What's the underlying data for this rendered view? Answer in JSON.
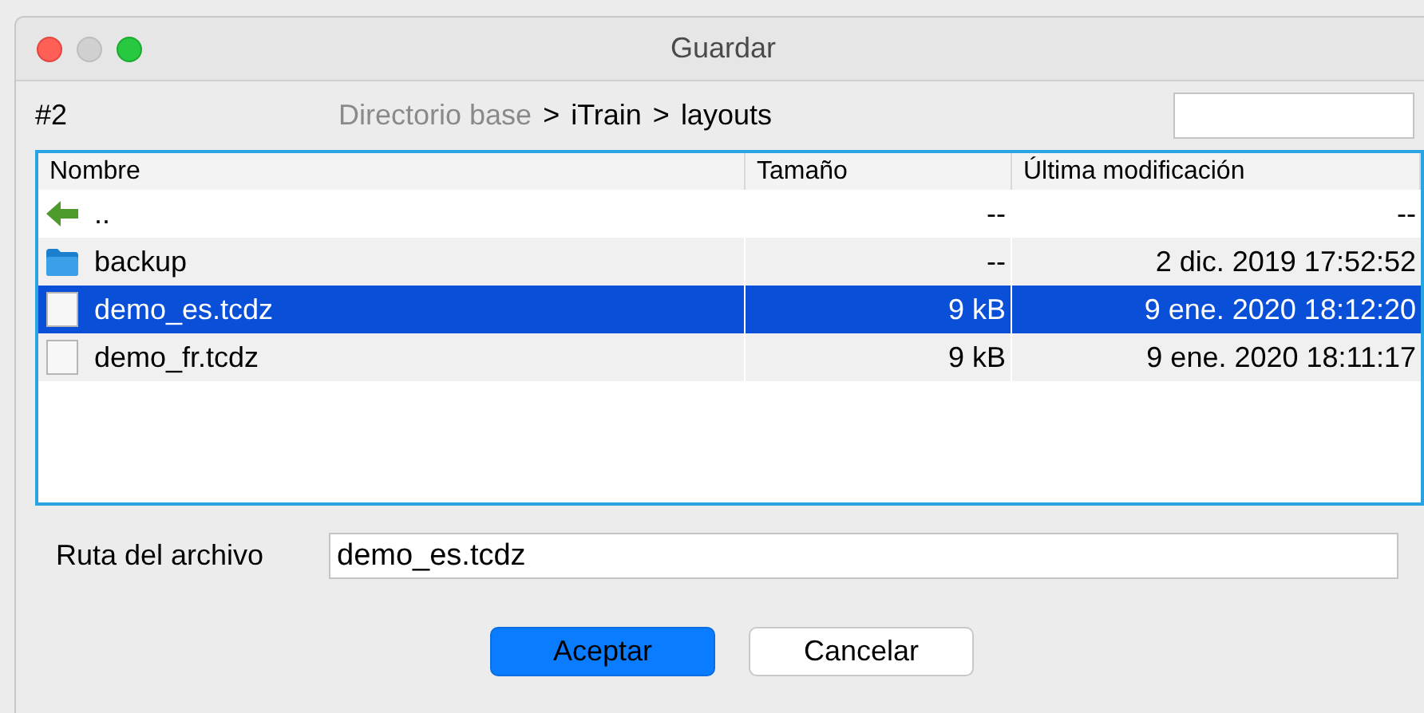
{
  "window": {
    "title": "Guardar"
  },
  "toolbar": {
    "label": "#2",
    "breadcrumb": [
      {
        "text": "Directorio base",
        "dimmed": true
      },
      {
        "text": ">",
        "dimmed": false
      },
      {
        "text": "iTrain",
        "dimmed": false
      },
      {
        "text": ">",
        "dimmed": false
      },
      {
        "text": "layouts",
        "dimmed": false
      }
    ]
  },
  "table": {
    "columns": [
      "Nombre",
      "Tamaño",
      "Última modificación"
    ],
    "rows": [
      {
        "kind": "parent",
        "name": "..",
        "size": "--",
        "modified": "--",
        "selected": false
      },
      {
        "kind": "folder",
        "name": "backup",
        "size": "--",
        "modified": "2 dic. 2019 17:52:52",
        "selected": false
      },
      {
        "kind": "file",
        "name": "demo_es.tcdz",
        "size": "9 kB",
        "modified": "9 ene. 2020 18:12:20",
        "selected": true
      },
      {
        "kind": "file",
        "name": "demo_fr.tcdz",
        "size": "9 kB",
        "modified": "9 ene. 2020 18:11:17",
        "selected": false
      }
    ]
  },
  "path": {
    "label": "Ruta del archivo",
    "value": "demo_es.tcdz"
  },
  "buttons": [
    {
      "label": "Aceptar",
      "kind": "primary"
    },
    {
      "label": "Cancelar",
      "kind": "secondary"
    }
  ]
}
